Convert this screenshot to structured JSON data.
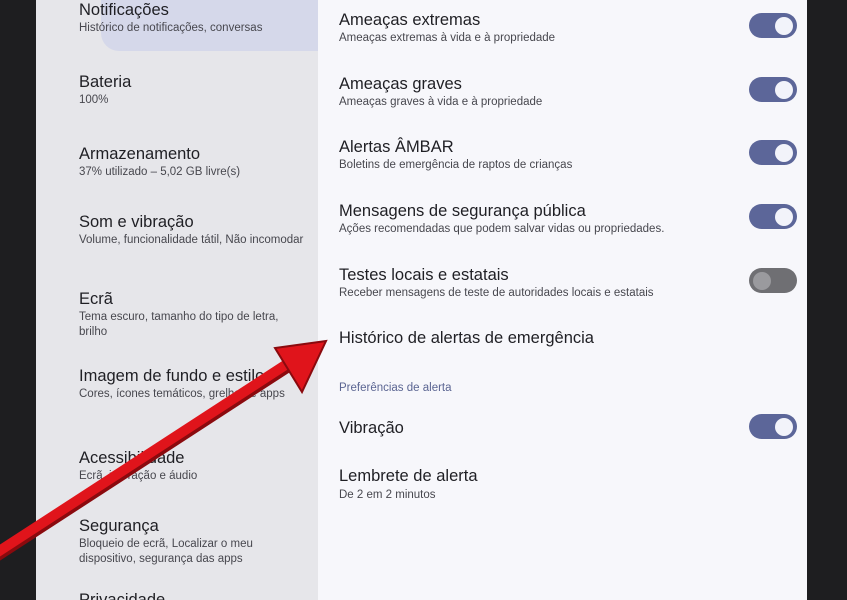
{
  "sidebar": {
    "items": [
      {
        "title": "Notificações",
        "sub": "Histórico de notificações, conversas"
      },
      {
        "title": "Bateria",
        "sub": "100%"
      },
      {
        "title": "Armazenamento",
        "sub": "37% utilizado – 5,02 GB livre(s)"
      },
      {
        "title": "Som e vibração",
        "sub": "Volume, funcionalidade tátil, Não incomodar"
      },
      {
        "title": "Ecrã",
        "sub": "Tema escuro, tamanho do tipo de letra, brilho"
      },
      {
        "title": "Imagem de fundo e estilo",
        "sub": "Cores, ícones temáticos, grelha de apps"
      },
      {
        "title": "Acessibilidade",
        "sub": "Ecrã, interação e áudio"
      },
      {
        "title": "Segurança",
        "sub": "Bloqueio de ecrã, Localizar o meu dispositivo, segurança das apps"
      },
      {
        "title": "Privacidade",
        "sub": ""
      }
    ]
  },
  "alerts": {
    "extreme": {
      "title": "Ameaças extremas",
      "sub": "Ameaças extremas à vida e à propriedade",
      "enabled": true
    },
    "severe": {
      "title": "Ameaças graves",
      "sub": "Ameaças graves à vida e à propriedade",
      "enabled": true
    },
    "amber": {
      "title": "Alertas ÂMBAR",
      "sub": "Boletins de emergência de raptos de crianças",
      "enabled": true
    },
    "public_safety": {
      "title": "Mensagens de segurança pública",
      "sub": "Ações recomendadas que podem salvar vidas ou propriedades.",
      "enabled": true
    },
    "tests": {
      "title": "Testes locais e estatais",
      "sub": "Receber mensagens de teste de autoridades locais e estatais",
      "enabled": false
    },
    "history": {
      "title": "Histórico de alertas de emergência"
    }
  },
  "preferences": {
    "heading": "Preferências de alerta",
    "vibration": {
      "title": "Vibração",
      "enabled": true
    },
    "reminder": {
      "title": "Lembrete de alerta",
      "sub": "De 2 em 2 minutos"
    }
  },
  "colors": {
    "toggle_on": "#5c6699",
    "toggle_off": "#6f6f73",
    "arrow": "#e0141b",
    "selected_bg": "#d5d8ea"
  }
}
